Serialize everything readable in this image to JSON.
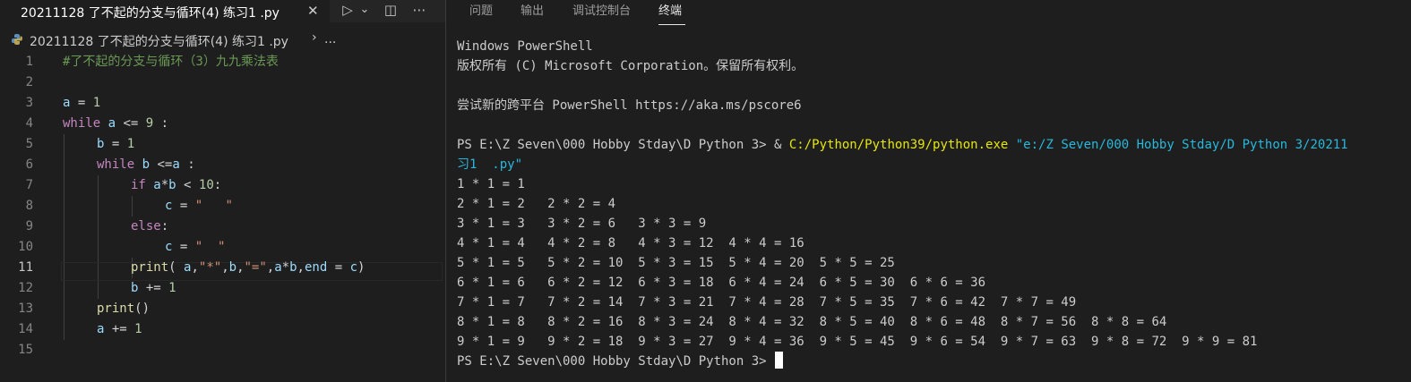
{
  "editor": {
    "tab_label": "20211128 了不起的分支与循环(4) 练习1  .py",
    "tab_close": "✕",
    "toolbar": {
      "run": "▷",
      "run_dropdown": "⌄",
      "split": "◫",
      "more": "⋯"
    },
    "breadcrumb_file": "20211128 了不起的分支与循环(4) 练习1  .py",
    "breadcrumb_sep": "›",
    "breadcrumb_more": "...",
    "line_numbers": [
      "1",
      "2",
      "3",
      "4",
      "5",
      "6",
      "7",
      "8",
      "9",
      "10",
      "11",
      "12",
      "13",
      "14",
      "15"
    ],
    "code": {
      "l1": "#了不起的分支与循环（3）九九乘法表",
      "l3_var": "a",
      "l3_op": " = ",
      "l3_num": "1",
      "l4_kw": "while",
      "l4_var": "a",
      "l4_op": " <= ",
      "l4_num": "9",
      "l4_colon": " :",
      "l5_var": "b",
      "l5_op": " = ",
      "l5_num": "1",
      "l6_kw": "while",
      "l6_var": "b",
      "l6_op": " <=",
      "l6_var2": "a",
      "l6_colon": " :",
      "l7_kw": "if",
      "l7_a": "a",
      "l7_mul": "*",
      "l7_b": "b",
      "l7_lt": " < ",
      "l7_num": "10",
      "l7_colon": ":",
      "l8_var": "c",
      "l8_op": " = ",
      "l8_str": "\"   \"",
      "l9_kw": "else",
      "l9_colon": ":",
      "l10_var": "c",
      "l10_op": " = ",
      "l10_str": "\"  \"",
      "l11_fn": "print",
      "l11_p1": "( ",
      "l11_a": "a",
      "l11_c1": ",",
      "l11_s1": "\"*\"",
      "l11_c2": ",",
      "l11_b": "b",
      "l11_c3": ",",
      "l11_s2": "\"=\"",
      "l11_c4": ",",
      "l11_a2": "a",
      "l11_mul": "*",
      "l11_b2": "b",
      "l11_c5": ",",
      "l11_end": "end",
      "l11_eq": " = ",
      "l11_c": "c",
      "l11_p2": ")",
      "l12_var": "b",
      "l12_op": " += ",
      "l12_num": "1",
      "l13_fn": "print",
      "l13_paren": "()",
      "l14_var": "a",
      "l14_op": " += ",
      "l14_num": "1"
    }
  },
  "panel": {
    "tabs": [
      "问题",
      "输出",
      "调试控制台",
      "终端"
    ],
    "active_tab": "终端"
  },
  "terminal": {
    "lines": [
      "Windows PowerShell",
      "版权所有 (C) Microsoft Corporation。保留所有权利。",
      "",
      "尝试新的跨平台 PowerShell https://aka.ms/pscore6",
      ""
    ],
    "cmd_prompt": "PS E:\\Z Seven\\000 Hobby Stday\\D Python 3> & ",
    "cmd_exe": "C:/Python/Python39/python.exe",
    "cmd_arg": " \"e:/Z Seven/000 Hobby Stday/D Python 3/20211",
    "cmd_arg_wrap": "习1  .py\"",
    "output": [
      "1 * 1 = 1",
      "2 * 1 = 2   2 * 2 = 4",
      "3 * 1 = 3   3 * 2 = 6   3 * 3 = 9",
      "4 * 1 = 4   4 * 2 = 8   4 * 3 = 12  4 * 4 = 16",
      "5 * 1 = 5   5 * 2 = 10  5 * 3 = 15  5 * 4 = 20  5 * 5 = 25",
      "6 * 1 = 6   6 * 2 = 12  6 * 3 = 18  6 * 4 = 24  6 * 5 = 30  6 * 6 = 36",
      "7 * 1 = 7   7 * 2 = 14  7 * 3 = 21  7 * 4 = 28  7 * 5 = 35  7 * 6 = 42  7 * 7 = 49",
      "8 * 1 = 8   8 * 2 = 16  8 * 3 = 24  8 * 4 = 32  8 * 5 = 40  8 * 6 = 48  8 * 7 = 56  8 * 8 = 64",
      "9 * 1 = 9   9 * 2 = 18  9 * 3 = 27  9 * 4 = 36  9 * 5 = 45  9 * 6 = 54  9 * 7 = 63  9 * 8 = 72  9 * 9 = 81"
    ],
    "final_prompt": "PS E:\\Z Seven\\000 Hobby Stday\\D Python 3> "
  },
  "colors": {
    "background": "#1e1e1e",
    "keyword": "#c586c0",
    "variable": "#9cdcfe",
    "number": "#b5cea8",
    "string": "#ce9178",
    "comment": "#6a9955",
    "function": "#dcdcaa",
    "terminal_exe": "#e5e510",
    "terminal_arg": "#29b8db"
  }
}
